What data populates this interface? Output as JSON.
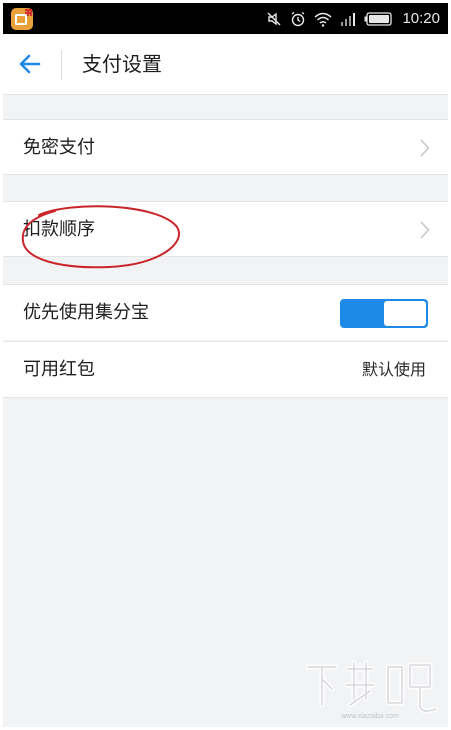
{
  "status_bar": {
    "time": "10:20",
    "icons": [
      "app-notification-icon",
      "mute-icon",
      "alarm-icon",
      "wifi-icon",
      "signal-icon",
      "battery-icon"
    ]
  },
  "header": {
    "back_icon": "back-arrow-icon",
    "title": "支付设置"
  },
  "settings": {
    "items": [
      {
        "label": "免密支付",
        "type": "link",
        "icon": "chevron-right-icon"
      },
      {
        "label": "扣款顺序",
        "type": "link",
        "icon": "chevron-right-icon"
      },
      {
        "label": "优先使用集分宝",
        "type": "toggle",
        "toggle_on": true
      },
      {
        "label": "可用红包",
        "type": "value",
        "value": "默认使用"
      }
    ]
  },
  "watermark": {
    "text": "下载吧",
    "url_text": "www.xiazaiba.com"
  },
  "colors": {
    "accent": "#1e89e6",
    "background": "#f2f3f5",
    "annotation": "#c8262b",
    "status_bar": "#000000"
  }
}
